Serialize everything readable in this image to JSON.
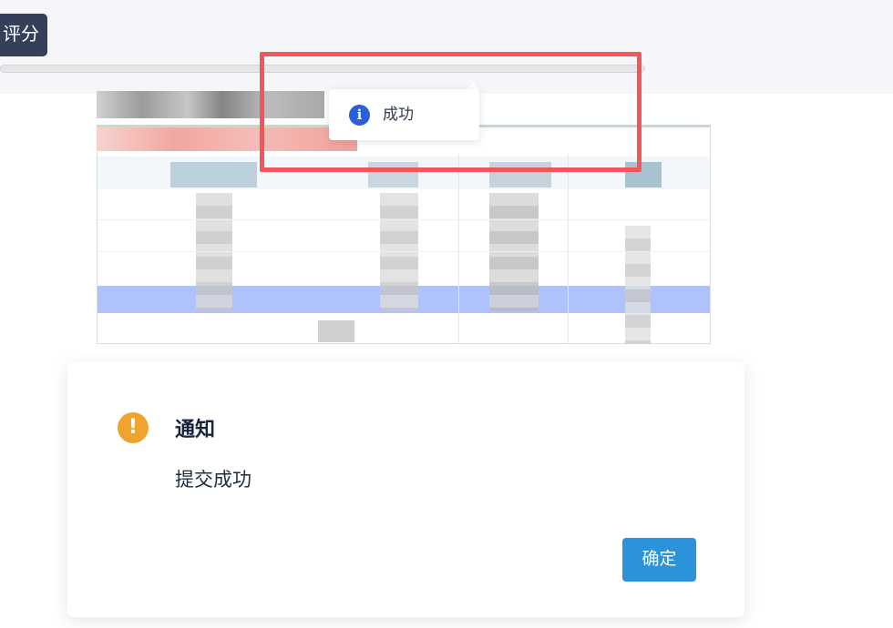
{
  "toolbar": {
    "score_button_label": "评分"
  },
  "message": {
    "icon": "info-icon",
    "text": "成功"
  },
  "dialog": {
    "icon": "warning-icon",
    "title": "通知",
    "message": "提交成功",
    "confirm_label": "确定"
  },
  "colors": {
    "score_button": "#34405a",
    "highlight_box": "#f2555a",
    "info_icon": "#2a5fd8",
    "warning_icon": "#f0a430",
    "confirm_button": "#2b93d9"
  }
}
